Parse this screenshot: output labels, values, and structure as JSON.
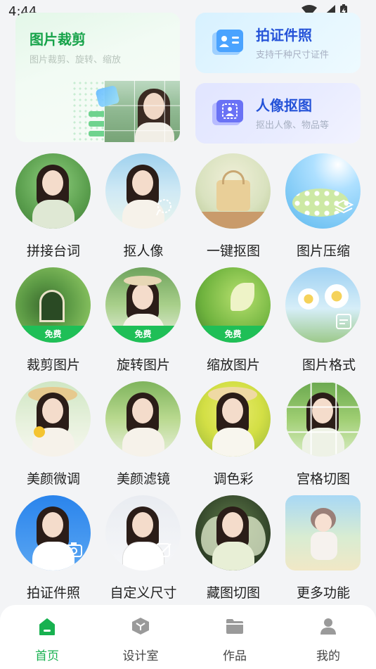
{
  "status_bar": {
    "time": "4:44"
  },
  "cards": {
    "crop": {
      "title": "图片裁剪",
      "subtitle": "图片裁剪、旋转、缩放"
    },
    "id_photo": {
      "title": "拍证件照",
      "subtitle": "支持千种尺寸证件"
    },
    "portrait": {
      "title": "人像抠图",
      "subtitle": "抠出人像、物品等"
    }
  },
  "features": [
    {
      "label": "拼接台词"
    },
    {
      "label": "抠人像"
    },
    {
      "label": "一键抠图"
    },
    {
      "label": "图片压缩"
    },
    {
      "label": "裁剪图片",
      "badge": "免费"
    },
    {
      "label": "旋转图片",
      "badge": "免费"
    },
    {
      "label": "缩放图片",
      "badge": "免费"
    },
    {
      "label": "图片格式"
    },
    {
      "label": "美颜微调"
    },
    {
      "label": "美颜滤镜"
    },
    {
      "label": "调色彩"
    },
    {
      "label": "宫格切图"
    },
    {
      "label": "拍证件照"
    },
    {
      "label": "自定义尺寸"
    },
    {
      "label": "藏图切图"
    },
    {
      "label": "更多功能"
    }
  ],
  "nav": [
    {
      "label": "首页",
      "icon": "home-icon",
      "active": true
    },
    {
      "label": "设计室",
      "icon": "cube-icon"
    },
    {
      "label": "作品",
      "icon": "folder-icon"
    },
    {
      "label": "我的",
      "icon": "person-icon"
    }
  ],
  "colors": {
    "accent": "#18b150",
    "card_blue": "#2553d8",
    "free_badge": "#1fbf57"
  }
}
